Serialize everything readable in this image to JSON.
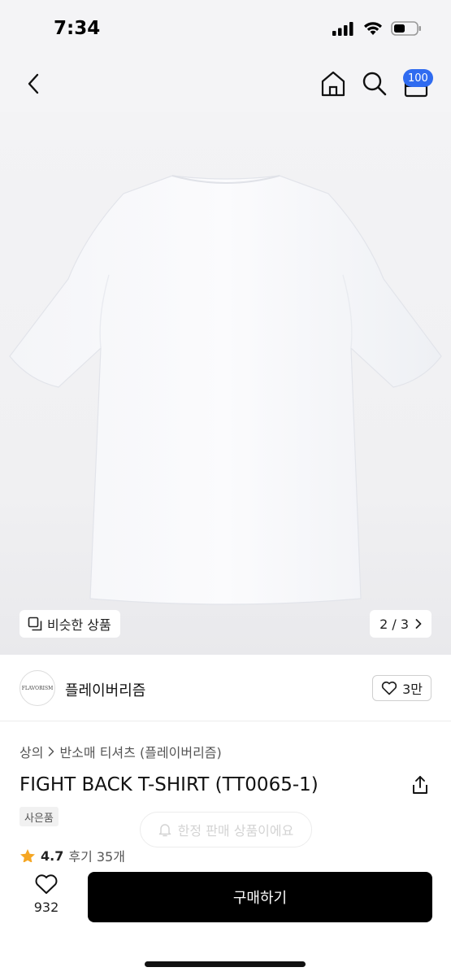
{
  "status_bar": {
    "time": "7:34",
    "icons": [
      "signal-icon",
      "wifi-icon",
      "battery-icon"
    ]
  },
  "nav": {
    "back_icon": "chevron-left-icon",
    "home_icon": "home-icon",
    "search_icon": "search-icon",
    "cart_icon": "cart-icon",
    "cart_badge": "100",
    "badge_color": "#2f6bf0"
  },
  "gallery": {
    "similar_label": "비슷한 상품",
    "page_indicator": "2 / 3"
  },
  "shop": {
    "logo_text": "FLAVORISM",
    "name": "플레이버리즘",
    "follow_count": "3만"
  },
  "product": {
    "breadcrumb": [
      "상의",
      "반소매 티셔츠 (플레이버리즘)"
    ],
    "title": "FIGHT BACK T-SHIRT (TT0065-1)",
    "gift_tag": "사은품",
    "rating": "4.7",
    "reviews": "후기 35개"
  },
  "toast": {
    "text": "한정 판매 상품이에요"
  },
  "bottom_bar": {
    "like_count": "932",
    "buy_label": "구매하기"
  },
  "colors": {
    "accent": "#000000",
    "star": "#f5a623"
  }
}
